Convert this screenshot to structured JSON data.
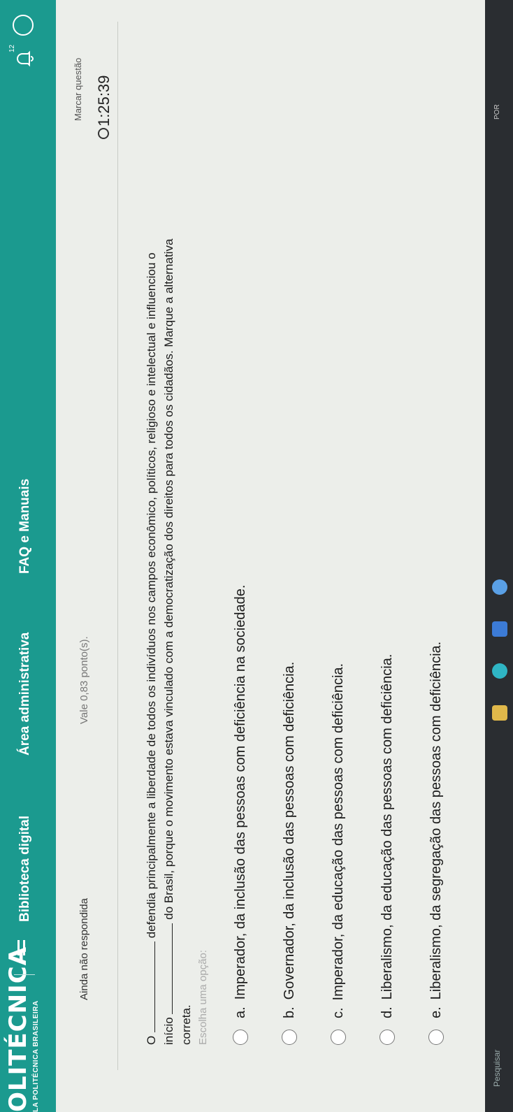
{
  "header": {
    "logo": "OLITÉCNICA",
    "logo_sub": "LA POLITÉCNICA BRASILEIRA",
    "nav": [
      "Biblioteca digital",
      "Área administrativa",
      "FAQ e Manuais"
    ],
    "bell_badge": "12"
  },
  "question": {
    "status": "Ainda não respondida",
    "points": "Vale 0,83 ponto(s).",
    "flag": "Marcar questão",
    "timer": "1:25:39",
    "text_prefix": "O",
    "text_part1": "defendia principalmente a liberdade de todos os indivíduos nos campos econômico, políticos, religioso e intelectual e influenciou o",
    "text_start": "início",
    "text_part2": "do Brasil, porque o movimento estava vinculado com a democratização dos direitos para todos os cidadãos. Marque a alternativa",
    "text_end": "correta.",
    "choose": "Escolha uma opção:",
    "options": [
      {
        "letter": "a.",
        "text": "Imperador, da inclusão das pessoas com deficiência na sociedade."
      },
      {
        "letter": "b.",
        "text": "Governador, da inclusão das pessoas com deficiência."
      },
      {
        "letter": "c.",
        "text": "Imperador, da educação das pessoas com deficiência."
      },
      {
        "letter": "d.",
        "text": "Liberalismo, da educação das pessoas com deficiência."
      },
      {
        "letter": "e.",
        "text": "Liberalismo, da segregação das pessoas com deficiência."
      }
    ]
  },
  "taskbar": {
    "search": "Pesquisar",
    "lang": "POR"
  },
  "colors": {
    "header": "#1b9a8f",
    "background": "#eceeea"
  }
}
